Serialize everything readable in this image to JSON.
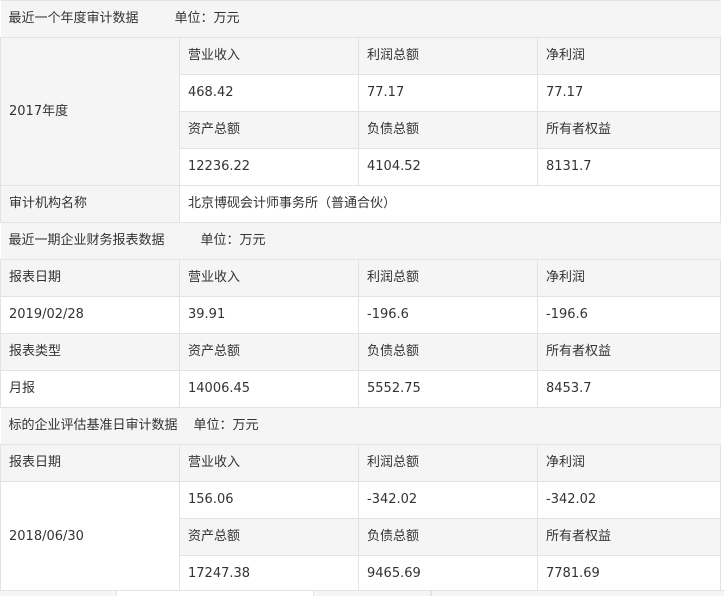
{
  "section1": {
    "title": "最近一个年度审计数据",
    "unit": "单位：万元",
    "period": "2017年度",
    "labels": [
      "营业收入",
      "利润总额",
      "净利润"
    ],
    "values": [
      "468.42",
      "77.17",
      "77.17"
    ],
    "labels2": [
      "资产总额",
      "负债总额",
      "所有者权益"
    ],
    "values2": [
      "12236.22",
      "4104.52",
      "8131.7"
    ],
    "auditor_label": "审计机构名称",
    "auditor_value": "北京博砚会计师事务所（普通合伙）"
  },
  "section2": {
    "title": "最近一期企业财务报表数据",
    "unit": "单位：万元",
    "date_label": "报表日期",
    "date_value": "2019/02/28",
    "type_label": "报表类型",
    "type_value": "月报",
    "labels": [
      "营业收入",
      "利润总额",
      "净利润"
    ],
    "values": [
      "39.91",
      "-196.6",
      "-196.6"
    ],
    "labels2": [
      "资产总额",
      "负债总额",
      "所有者权益"
    ],
    "values2": [
      "14006.45",
      "5552.75",
      "8453.7"
    ]
  },
  "section3": {
    "title": "标的企业评估基准日审计数据",
    "unit": "单位：万元",
    "date_label": "报表日期",
    "date_value": "2018/06/30",
    "labels": [
      "营业收入",
      "利润总额",
      "净利润"
    ],
    "values": [
      "156.06",
      "-342.02",
      "-342.02"
    ],
    "labels2": [
      "资产总额",
      "负债总额",
      "所有者权益"
    ],
    "values2": [
      "17247.38",
      "9465.69",
      "7781.69"
    ]
  }
}
